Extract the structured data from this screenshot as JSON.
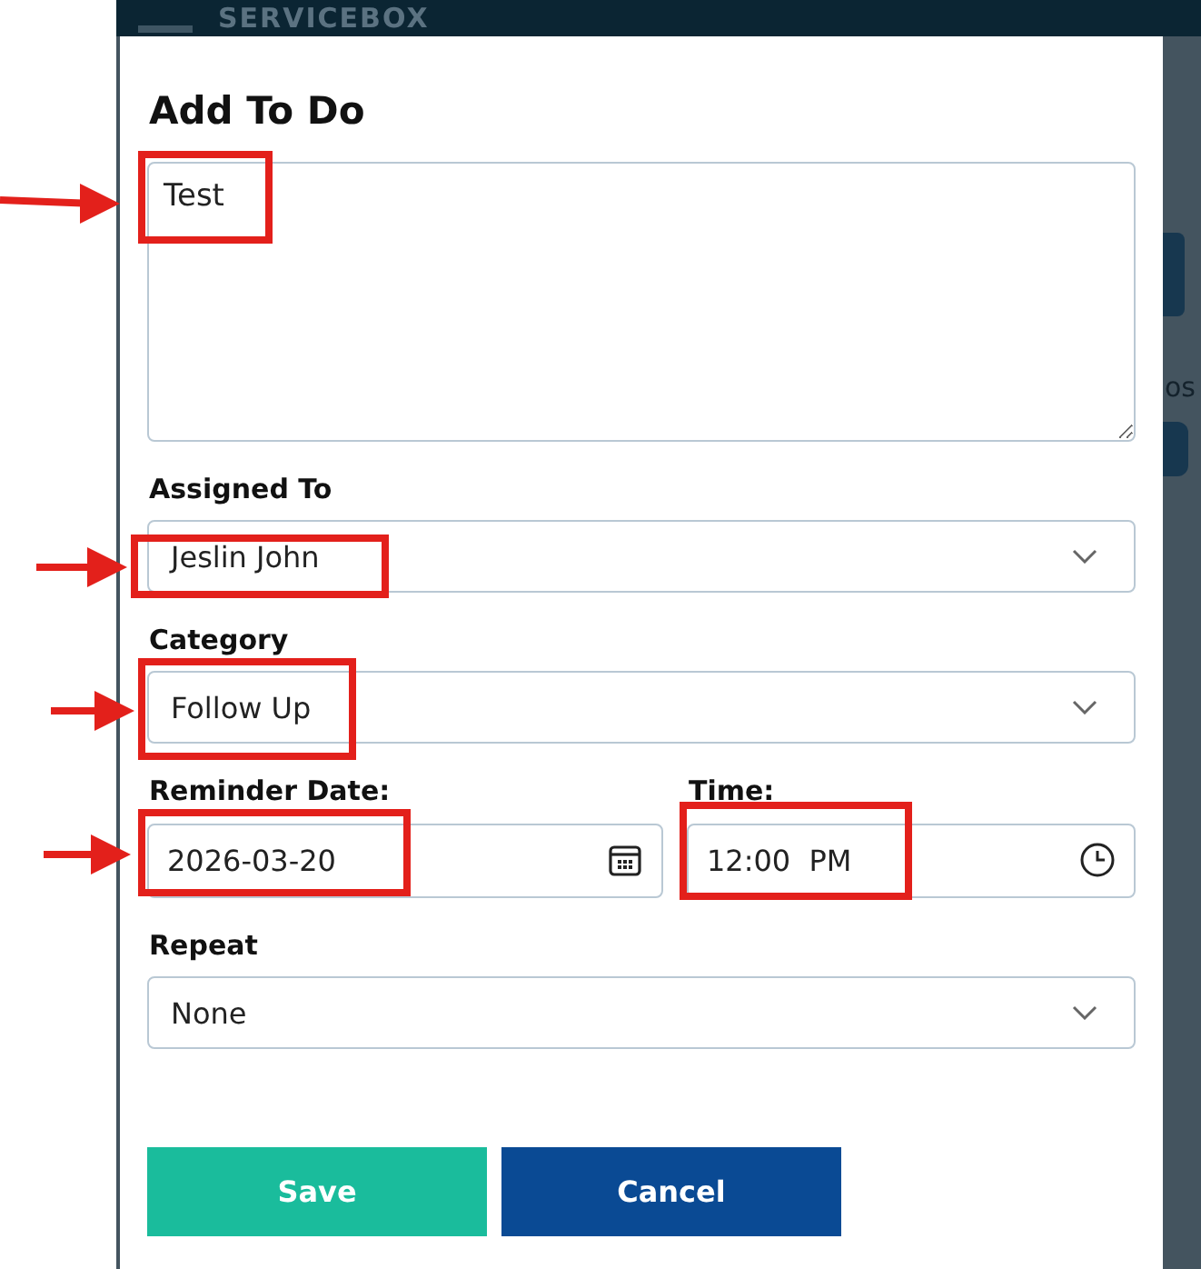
{
  "header": {
    "logo": "SERVICEBOX"
  },
  "background": {
    "fragment": "os"
  },
  "dialog": {
    "title": "Add To Do",
    "description": {
      "value": "Test"
    },
    "fields": [
      {
        "kind": "select",
        "label": "Assigned To",
        "value": "Jeslin John"
      },
      {
        "kind": "select",
        "label": "Category",
        "value": "Follow Up"
      }
    ],
    "reminder": [
      {
        "kind": "date",
        "label": "Reminder Date:",
        "value": "2026-03-20"
      },
      {
        "kind": "time",
        "label": "Time:",
        "value": "12:00  PM"
      }
    ],
    "repeat": {
      "kind": "select",
      "label": "Repeat",
      "value": "None"
    },
    "buttons": [
      {
        "kind": "primary",
        "label": "Save"
      },
      {
        "kind": "secondary",
        "label": "Cancel"
      }
    ]
  }
}
